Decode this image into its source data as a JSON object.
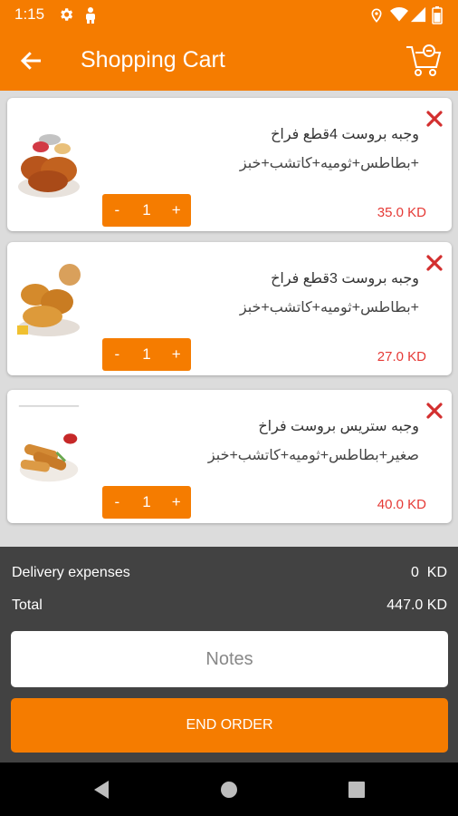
{
  "status_bar": {
    "time": "1:15",
    "icons": [
      "gear-icon",
      "android-icon",
      "location-icon",
      "wifi-icon",
      "signal-icon",
      "battery-icon"
    ]
  },
  "header": {
    "title": "Shopping Cart",
    "back_icon": "arrow-left-icon",
    "cart_icon": "cart-icon"
  },
  "cart": {
    "items": [
      {
        "name": "وجبه بروست 4قطع فراخ",
        "description": "+بطاطس+ثوميه+كاتشب+خبز",
        "quantity": "1",
        "decrement": "-",
        "increment": "+",
        "price": "35.0 KD",
        "image": "fried-chicken-photo"
      },
      {
        "name": "وجبه بروست 3قطع فراخ",
        "description": "+بطاطس+ثوميه+كاتشب+خبز",
        "quantity": "1",
        "decrement": "-",
        "increment": "+",
        "price": "27.0 KD",
        "image": "fried-chicken-bun-photo"
      },
      {
        "name": "وجبه ستريس بروست فراخ",
        "description": "صغير+بطاطس+ثوميه+كاتشب+خبز",
        "quantity": "1",
        "decrement": "-",
        "increment": "+",
        "price": "40.0 KD",
        "image": "chicken-strips-photo"
      }
    ]
  },
  "summary": {
    "delivery_label": "Delivery expenses",
    "delivery_value": "0  KD",
    "total_label": "Total",
    "total_value": "447.0 KD",
    "notes_placeholder": "Notes",
    "end_order_label": "END ORDER"
  },
  "colors": {
    "primary": "#f57c00",
    "price": "#e53935",
    "remove": "#d32f2f",
    "bottom_panel": "#424242"
  },
  "nav_bar": {
    "icons": [
      "back-triangle-icon",
      "home-circle-icon",
      "recents-square-icon"
    ]
  }
}
